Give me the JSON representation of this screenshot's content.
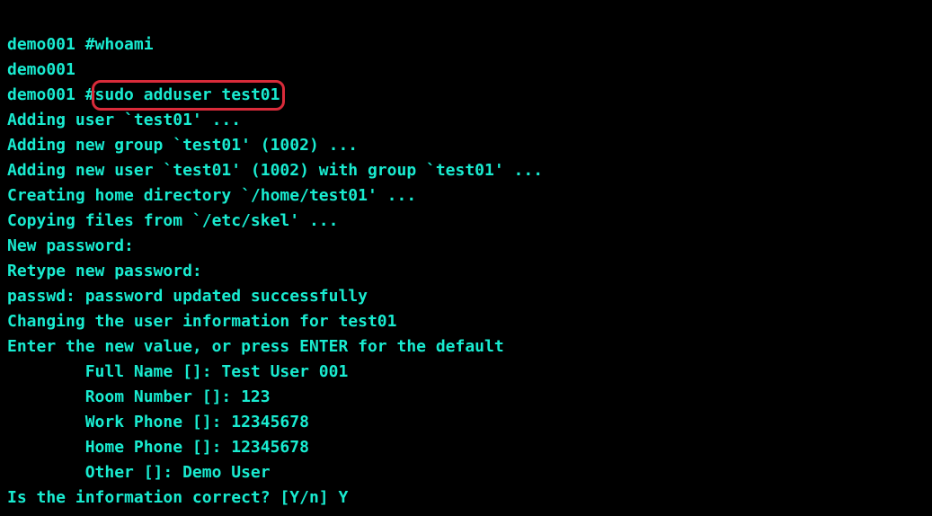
{
  "terminal": {
    "lines": {
      "l00_prompt": "demo001 #",
      "l00_cmd": "whoami",
      "l01": "demo001",
      "l02_prompt": "demo001 #",
      "l02_cmd": "sudo adduser test01",
      "l03": "Adding user `test01' ...",
      "l04": "Adding new group `test01' (1002) ...",
      "l05": "Adding new user `test01' (1002) with group `test01' ...",
      "l06": "Creating home directory `/home/test01' ...",
      "l07": "Copying files from `/etc/skel' ...",
      "l08": "New password:",
      "l09": "Retype new password:",
      "l10": "passwd: password updated successfully",
      "l11": "Changing the user information for test01",
      "l12": "Enter the new value, or press ENTER for the default",
      "l13": "        Full Name []: Test User 001",
      "l14": "        Room Number []: 123",
      "l15": "        Work Phone []: 12345678",
      "l16": "        Home Phone []: 12345678",
      "l17": "        Other []: Demo User",
      "l18": "Is the information correct? [Y/n] Y"
    }
  }
}
